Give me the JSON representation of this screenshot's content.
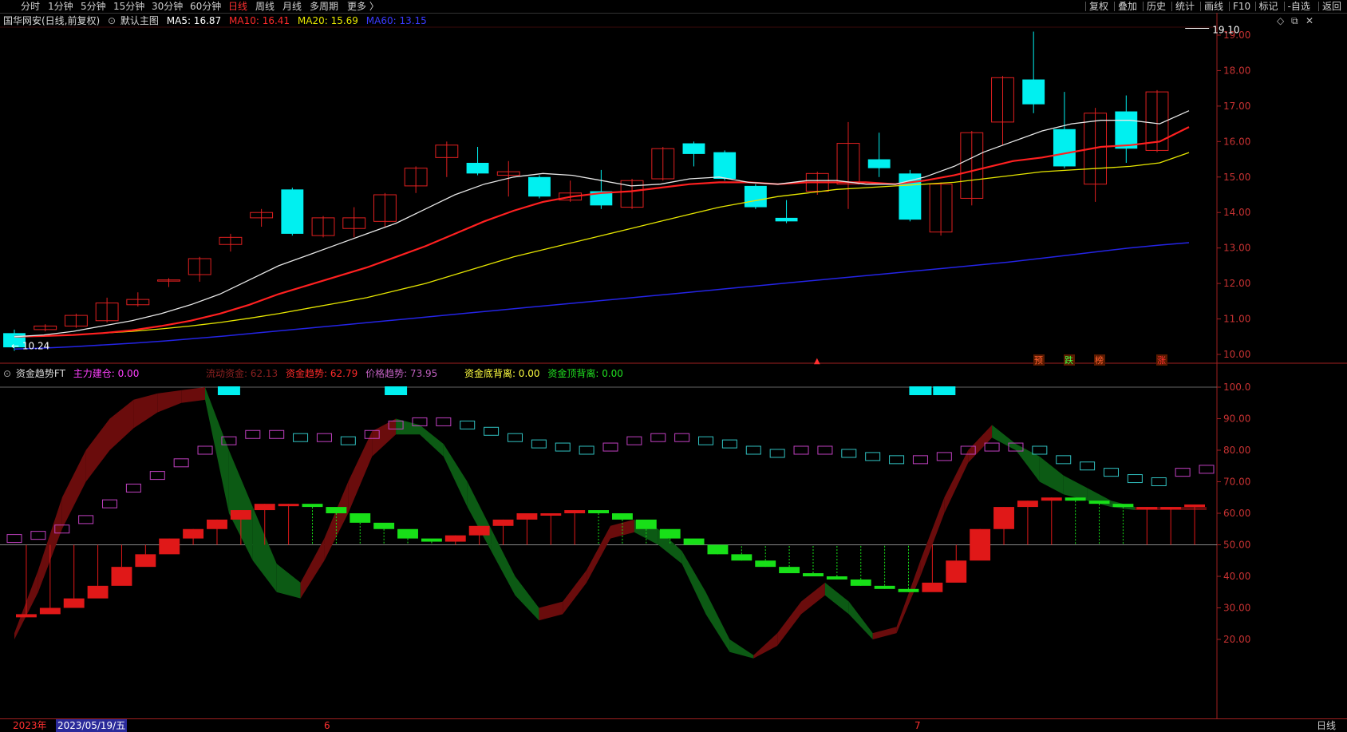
{
  "toolbar": {
    "periods": [
      {
        "label": "分时",
        "selected": false
      },
      {
        "label": "1分钟",
        "selected": false
      },
      {
        "label": "5分钟",
        "selected": false
      },
      {
        "label": "15分钟",
        "selected": false
      },
      {
        "label": "30分钟",
        "selected": false
      },
      {
        "label": "60分钟",
        "selected": false
      },
      {
        "label": "日线",
        "selected": true
      },
      {
        "label": "周线",
        "selected": false
      },
      {
        "label": "月线",
        "selected": false
      },
      {
        "label": "多周期",
        "selected": false
      },
      {
        "label": "更多 〉",
        "selected": false
      }
    ],
    "right_items": [
      "复权",
      "叠加",
      "历史",
      "统计",
      "画线",
      "F10",
      "标记",
      "-自选",
      "返回"
    ]
  },
  "main_info": {
    "title": "国华网安(日线,前复权)",
    "template": "默认主图",
    "ma5": "MA5: 16.87",
    "ma10": "MA10: 16.41",
    "ma20": "MA20: 15.69",
    "ma60": "MA60: 13.15",
    "colors": {
      "ma5": "#ffffff",
      "ma10": "#ff2020",
      "ma20": "#e6e600",
      "ma60": "#2020ff"
    }
  },
  "sub_info": {
    "title": "资金趋势FT",
    "main_force": "主力建仓: 0.00",
    "liquidity": "流动资金: 62.13",
    "fund_trend": "资金趋势: 62.79",
    "price_trend": "价格趋势: 73.95",
    "bottom_div": "资金底背离: 0.00",
    "top_div": "资金顶背离: 0.00"
  },
  "price_axis": [
    "19.00",
    "18.00",
    "17.00",
    "16.00",
    "15.00",
    "14.00",
    "13.00",
    "12.00",
    "11.00",
    "10.00"
  ],
  "sub_axis": [
    "100.0",
    "90.00",
    "80.00",
    "70.00",
    "60.00",
    "50.00",
    "40.00",
    "30.00",
    "20.00"
  ],
  "annotations": {
    "high": "19.10",
    "low": "10.24"
  },
  "signals": [
    "预",
    "跌",
    "榜",
    "涨"
  ],
  "bottom_bar": {
    "year": "2023年",
    "date": "2023/05/19/五",
    "m6": "6",
    "m7": "7",
    "period": "日线"
  },
  "chart_data": {
    "type": "candlestick",
    "candles": [
      {
        "o": 10.6,
        "c": 10.2,
        "h": 10.7,
        "l": 10.1
      },
      {
        "o": 10.7,
        "c": 10.8,
        "h": 10.85,
        "l": 10.65
      },
      {
        "o": 10.8,
        "c": 11.1,
        "h": 11.15,
        "l": 10.75
      },
      {
        "o": 10.95,
        "c": 11.45,
        "h": 11.6,
        "l": 10.9
      },
      {
        "o": 11.4,
        "c": 11.55,
        "h": 11.75,
        "l": 11.35
      },
      {
        "o": 12.1,
        "c": 12.1,
        "h": 12.15,
        "l": 11.9
      },
      {
        "o": 12.25,
        "c": 12.7,
        "h": 12.75,
        "l": 12.05
      },
      {
        "o": 13.1,
        "c": 13.3,
        "h": 13.4,
        "l": 12.9
      },
      {
        "o": 13.85,
        "c": 14.0,
        "h": 14.1,
        "l": 13.6
      },
      {
        "o": 14.65,
        "c": 13.4,
        "h": 14.7,
        "l": 13.35
      },
      {
        "o": 13.35,
        "c": 13.85,
        "h": 13.9,
        "l": 13.3
      },
      {
        "o": 13.55,
        "c": 13.85,
        "h": 14.15,
        "l": 13.3
      },
      {
        "o": 13.75,
        "c": 14.5,
        "h": 14.55,
        "l": 13.6
      },
      {
        "o": 14.75,
        "c": 15.25,
        "h": 15.3,
        "l": 14.55
      },
      {
        "o": 15.55,
        "c": 15.9,
        "h": 16.0,
        "l": 15.0
      },
      {
        "o": 15.4,
        "c": 15.1,
        "h": 15.85,
        "l": 15.05
      },
      {
        "o": 15.05,
        "c": 15.15,
        "h": 15.45,
        "l": 14.45
      },
      {
        "o": 15.0,
        "c": 14.45,
        "h": 15.05,
        "l": 14.4
      },
      {
        "o": 14.35,
        "c": 14.55,
        "h": 14.9,
        "l": 14.3
      },
      {
        "o": 14.6,
        "c": 14.2,
        "h": 15.2,
        "l": 14.1
      },
      {
        "o": 14.15,
        "c": 14.9,
        "h": 14.95,
        "l": 14.1
      },
      {
        "o": 14.95,
        "c": 15.8,
        "h": 15.85,
        "l": 14.9
      },
      {
        "o": 15.95,
        "c": 15.65,
        "h": 16.0,
        "l": 15.3
      },
      {
        "o": 15.7,
        "c": 14.95,
        "h": 15.75,
        "l": 14.9
      },
      {
        "o": 14.75,
        "c": 14.15,
        "h": 14.8,
        "l": 14.1
      },
      {
        "o": 13.85,
        "c": 13.75,
        "h": 14.35,
        "l": 13.7
      },
      {
        "o": 14.6,
        "c": 15.1,
        "h": 15.15,
        "l": 14.5
      },
      {
        "o": 14.8,
        "c": 15.95,
        "h": 16.55,
        "l": 14.1
      },
      {
        "o": 15.5,
        "c": 15.25,
        "h": 16.25,
        "l": 15.0
      },
      {
        "o": 15.1,
        "c": 13.8,
        "h": 15.2,
        "l": 13.75
      },
      {
        "o": 13.45,
        "c": 14.8,
        "h": 14.85,
        "l": 13.35
      },
      {
        "o": 14.4,
        "c": 16.25,
        "h": 16.3,
        "l": 14.2
      },
      {
        "o": 16.55,
        "c": 17.8,
        "h": 17.85,
        "l": 15.9
      },
      {
        "o": 17.75,
        "c": 17.05,
        "h": 19.1,
        "l": 16.8
      },
      {
        "o": 16.35,
        "c": 15.3,
        "h": 17.4,
        "l": 15.25
      },
      {
        "o": 14.8,
        "c": 16.8,
        "h": 16.95,
        "l": 14.3
      },
      {
        "o": 16.85,
        "c": 15.8,
        "h": 17.3,
        "l": 15.4
      },
      {
        "o": 15.75,
        "c": 17.4,
        "h": 17.45,
        "l": 15.7
      }
    ],
    "ma5": [
      10.5,
      10.55,
      10.65,
      10.8,
      10.95,
      11.15,
      11.4,
      11.7,
      12.1,
      12.5,
      12.8,
      13.1,
      13.4,
      13.7,
      14.1,
      14.5,
      14.8,
      15.0,
      15.1,
      15.05,
      14.9,
      14.75,
      14.8,
      14.95,
      15.0,
      14.85,
      14.8,
      14.9,
      14.9,
      14.8,
      14.8,
      15.0,
      15.3,
      15.7,
      16.0,
      16.3,
      16.5,
      16.6,
      16.6,
      16.5,
      16.87
    ],
    "ma10": [
      10.5,
      10.52,
      10.55,
      10.6,
      10.68,
      10.8,
      10.95,
      11.15,
      11.4,
      11.7,
      11.95,
      12.2,
      12.45,
      12.75,
      13.05,
      13.4,
      13.75,
      14.05,
      14.3,
      14.45,
      14.55,
      14.6,
      14.7,
      14.8,
      14.85,
      14.85,
      14.8,
      14.85,
      14.85,
      14.85,
      14.8,
      14.9,
      15.05,
      15.25,
      15.45,
      15.55,
      15.7,
      15.85,
      15.9,
      16.0,
      16.41
    ],
    "ma20": [
      10.5,
      10.52,
      10.55,
      10.6,
      10.65,
      10.72,
      10.8,
      10.9,
      11.02,
      11.15,
      11.3,
      11.45,
      11.6,
      11.8,
      12.0,
      12.25,
      12.5,
      12.75,
      12.95,
      13.15,
      13.35,
      13.55,
      13.75,
      13.95,
      14.15,
      14.3,
      14.45,
      14.55,
      14.65,
      14.7,
      14.75,
      14.8,
      14.85,
      14.95,
      15.05,
      15.15,
      15.2,
      15.25,
      15.3,
      15.4,
      15.69
    ],
    "ma60": [
      10.15,
      10.18,
      10.22,
      10.27,
      10.32,
      10.38,
      10.45,
      10.52,
      10.6,
      10.68,
      10.76,
      10.84,
      10.92,
      11.0,
      11.08,
      11.16,
      11.24,
      11.32,
      11.4,
      11.48,
      11.56,
      11.64,
      11.72,
      11.8,
      11.88,
      11.96,
      12.04,
      12.12,
      12.2,
      12.28,
      12.36,
      12.44,
      12.52,
      12.6,
      12.7,
      12.8,
      12.9,
      13.0,
      13.08,
      13.15
    ],
    "sub": {
      "fund": [
        27,
        28,
        30,
        33,
        37,
        43,
        47,
        52,
        55,
        58,
        61,
        63,
        63,
        62,
        60,
        57,
        55,
        52,
        51,
        53,
        56,
        58,
        60,
        60,
        61,
        60,
        58,
        55,
        52,
        50,
        47,
        45,
        43,
        41,
        40,
        39,
        37,
        36,
        35,
        38,
        45,
        55,
        62,
        64,
        65,
        64,
        63,
        62,
        62,
        62,
        62.79
      ],
      "price": [
        52,
        53,
        55,
        58,
        63,
        68,
        72,
        76,
        80,
        83,
        85,
        85,
        84,
        84,
        83,
        85,
        88,
        89,
        89,
        88,
        86,
        84,
        82,
        81,
        80,
        81,
        83,
        84,
        84,
        83,
        82,
        80,
        79,
        80,
        80,
        79,
        78,
        77,
        77,
        78,
        80,
        81,
        81,
        80,
        77,
        75,
        73,
        71,
        70,
        73,
        73.95
      ],
      "band_hi": [
        22,
        42,
        65,
        80,
        90,
        96,
        98,
        99,
        100,
        80,
        62,
        44,
        38,
        52,
        70,
        86,
        90,
        88,
        82,
        70,
        55,
        40,
        30,
        32,
        42,
        56,
        58,
        55,
        48,
        35,
        20,
        15,
        22,
        32,
        38,
        32,
        22,
        24,
        45,
        65,
        80,
        88,
        82,
        78,
        72,
        68,
        64,
        62,
        62,
        62,
        62
      ],
      "band_lo": [
        20,
        35,
        55,
        70,
        80,
        87,
        92,
        95,
        96,
        60,
        45,
        35,
        33,
        45,
        60,
        78,
        85,
        85,
        78,
        62,
        48,
        34,
        26,
        28,
        38,
        52,
        54,
        50,
        44,
        28,
        16,
        14,
        18,
        28,
        34,
        28,
        20,
        22,
        40,
        60,
        76,
        84,
        80,
        70,
        66,
        64,
        62,
        61,
        61,
        61,
        61
      ]
    }
  }
}
